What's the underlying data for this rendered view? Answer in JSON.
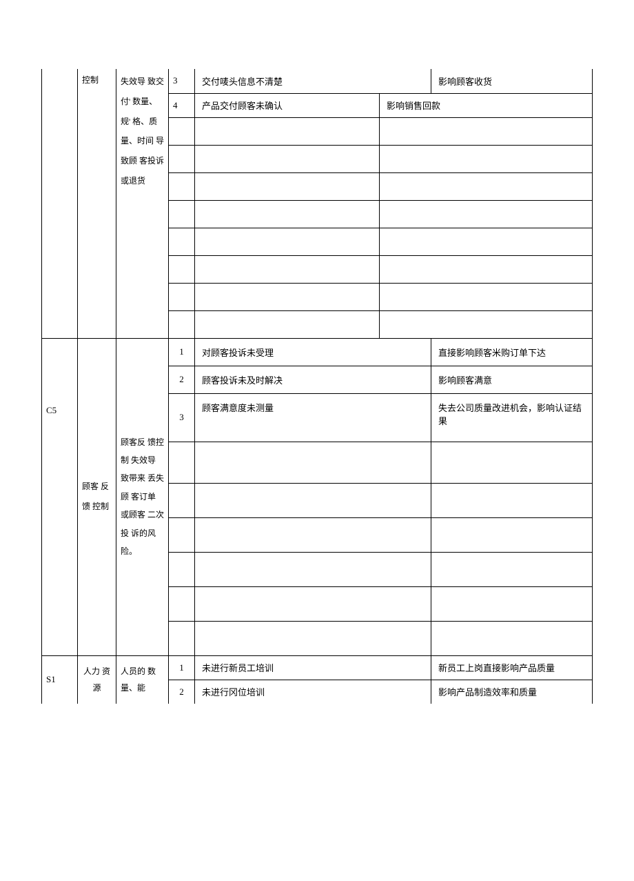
{
  "block1": {
    "col1": "",
    "col2": "控制",
    "col3": "失效导 致交付' 数量、规' 格、质 量、时间 导致顾 客投诉 或退货",
    "rows": [
      {
        "num": "3",
        "issue": "交付唛头信息不清楚",
        "effect": "影响顾客收货"
      },
      {
        "num": "4",
        "issue": "产品交付顾客未确认",
        "effect": "影响销售回款"
      }
    ]
  },
  "block2": {
    "col1": "C5",
    "col2": "顾客 反馈 控制",
    "col3": "顾客反 馈控制 失效导 致带来 丢失顾 客订单 或顾客 二次投 诉的风 险。",
    "rows": [
      {
        "num": "1",
        "issue": "对顾客投诉未受理",
        "effect": "直接影响顾客米购订单下达"
      },
      {
        "num": "2",
        "issue": "顾客投诉未及时解决",
        "effect": "影响顾客满意"
      },
      {
        "num": "3",
        "issue": "顾客满意度未测量",
        "effect": "失去公司质量改进机会，影响认证结果"
      }
    ]
  },
  "block3": {
    "col1": "S1",
    "col2": "人力 资源",
    "col3": "人员的 数量、能",
    "rows": [
      {
        "num": "1",
        "issue": "未进行新员工培训",
        "effect": "新员工上岗直接影响产品质量"
      },
      {
        "num": "2",
        "issue": "未进行冈位培训",
        "effect": "影响产品制造效率和质量"
      }
    ]
  }
}
